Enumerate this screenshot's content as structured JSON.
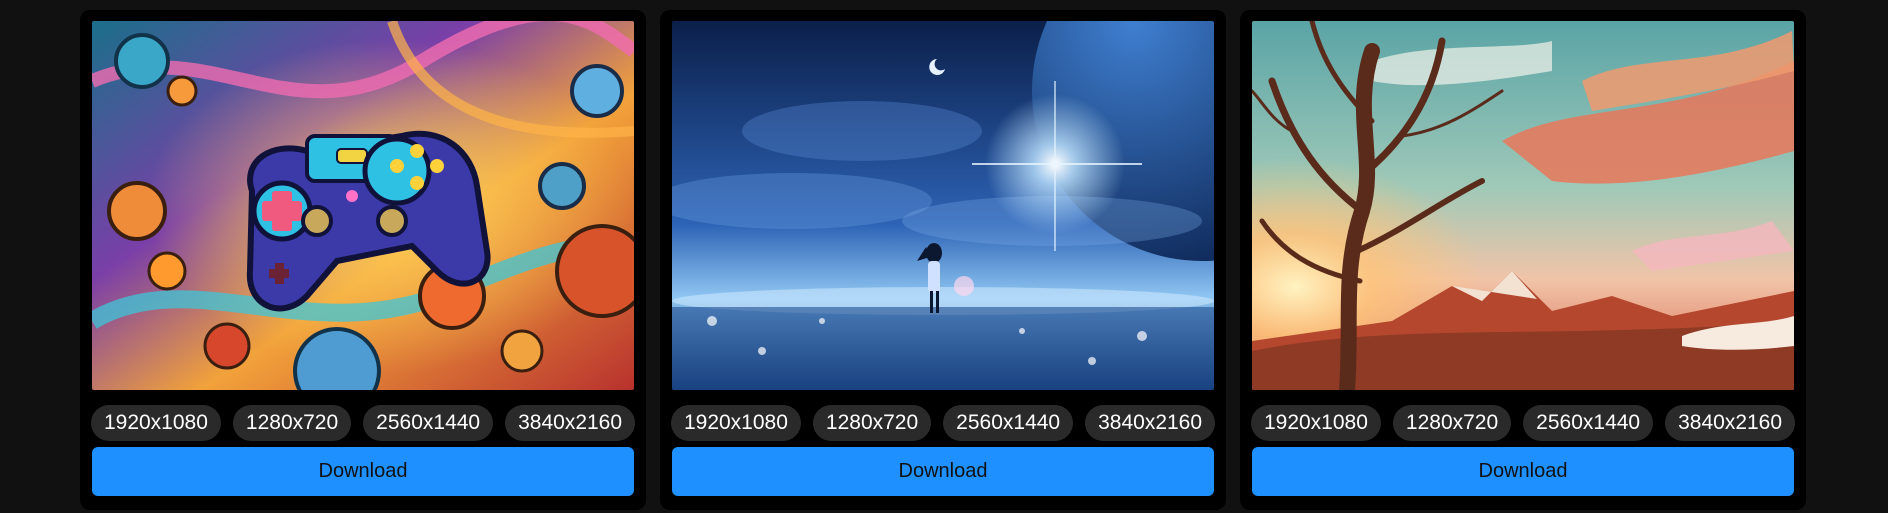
{
  "cards": [
    {
      "image_subject": "colorful game controller illustration",
      "resolutions": [
        "1920x1080",
        "1280x720",
        "2560x1440",
        "3840x2160"
      ],
      "download_label": "Download"
    },
    {
      "image_subject": "anime girl under starry blue sky with planet",
      "resolutions": [
        "1920x1080",
        "1280x720",
        "2560x1440",
        "3840x2160"
      ],
      "download_label": "Download"
    },
    {
      "image_subject": "bare tree at sunset landscape",
      "resolutions": [
        "1920x1080",
        "1280x720",
        "2560x1440",
        "3840x2160"
      ],
      "download_label": "Download"
    }
  ],
  "colors": {
    "page_bg": "#111111",
    "card_bg": "#000000",
    "pill_bg": "#2a2a2a",
    "button_bg": "#1e90ff"
  }
}
